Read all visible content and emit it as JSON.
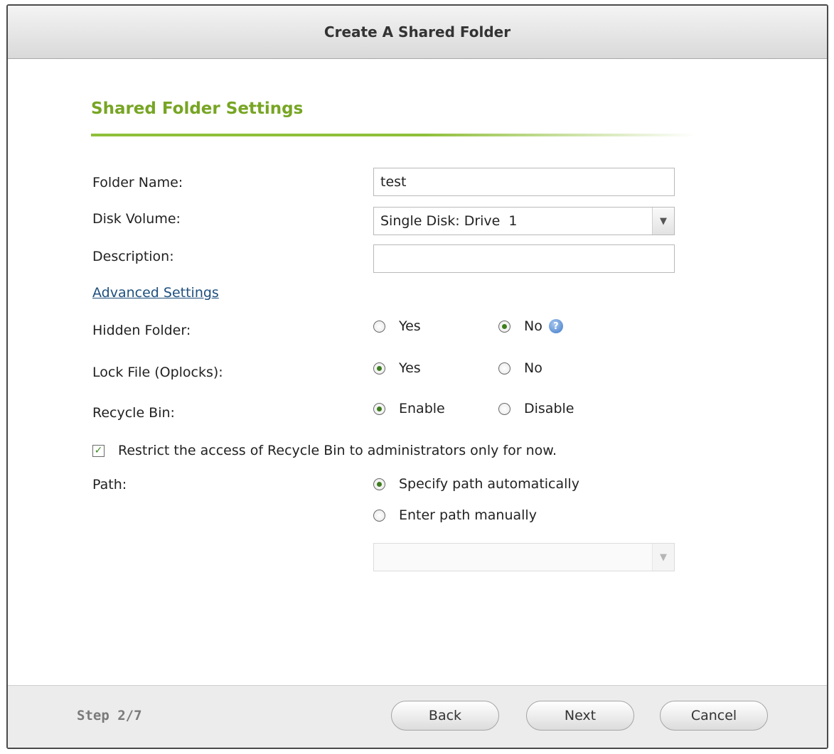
{
  "dialog": {
    "title": "Create A Shared Folder",
    "section_title": "Shared Folder Settings"
  },
  "form": {
    "folder_name": {
      "label": "Folder Name:",
      "value": "test"
    },
    "disk_volume": {
      "label": "Disk Volume:",
      "value": "Single Disk: Drive  1"
    },
    "description": {
      "label": "Description:",
      "value": ""
    },
    "advanced_link": "Advanced Settings",
    "hidden_folder": {
      "label": "Hidden Folder:",
      "opt_yes": "Yes",
      "opt_no": "No",
      "selected": "No"
    },
    "lock_file": {
      "label": "Lock File (Oplocks):",
      "opt_yes": "Yes",
      "opt_no": "No",
      "selected": "Yes"
    },
    "recycle_bin": {
      "label": "Recycle Bin:",
      "opt_enable": "Enable",
      "opt_disable": "Disable",
      "selected": "Enable"
    },
    "restrict_recycle": {
      "label": "Restrict the access of Recycle Bin to administrators only for now.",
      "checked": true
    },
    "path": {
      "label": "Path:",
      "opt_auto": "Specify path automatically",
      "opt_manual": "Enter path manually",
      "selected": "Specify path automatically",
      "manual_value": ""
    }
  },
  "footer": {
    "step": "Step 2/7",
    "back": "Back",
    "next": "Next",
    "cancel": "Cancel"
  },
  "icons": {
    "check": "check-icon",
    "dropdown": "chevron-down-icon",
    "help": "help-icon"
  },
  "colors": {
    "accent_green": "#77a524",
    "link_blue": "#1e4f7e",
    "radio_dot": "#3d7d1e"
  }
}
